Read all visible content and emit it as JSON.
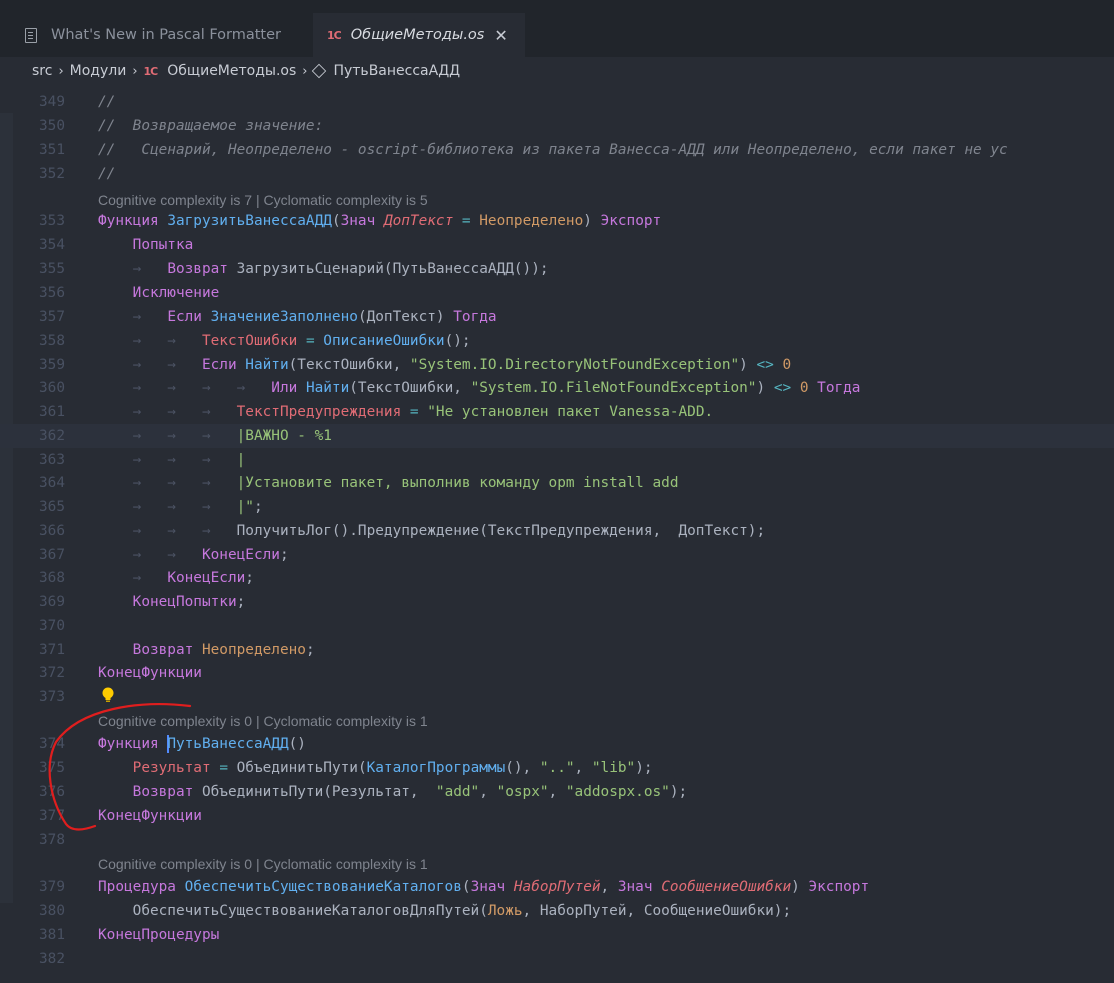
{
  "tabs": [
    {
      "label": "What's New in Pascal Formatter",
      "icon": "file-icon",
      "active": false
    },
    {
      "label": "ОбщиеМетоды.os",
      "icon": "1c-icon",
      "icon_text": "1С",
      "active": true,
      "close": "✕"
    }
  ],
  "breadcrumb": {
    "items": [
      "src",
      "Модули",
      "ОбщиеМетоды.os",
      "ПутьВанессаАДД"
    ],
    "separator": "›",
    "file_icon_text": "1С"
  },
  "lenses": {
    "l353": "Cognitive complexity is 7 | Cyclomatic complexity is 5",
    "l374": "Cognitive complexity is 0 | Cyclomatic complexity is 1",
    "l379": "Cognitive complexity is 0 | Cyclomatic complexity is 1"
  },
  "lines": [
    {
      "n": "349",
      "segs": [
        [
          "c",
          "//"
        ]
      ]
    },
    {
      "n": "350",
      "segs": [
        [
          "c",
          "//  Возвращаемое значение:"
        ]
      ]
    },
    {
      "n": "351",
      "segs": [
        [
          "c",
          "//   Сценарий, Неопределено - oscript-библиотека из пакета Ванесса-АДД или Неопределено, если пакет не ус"
        ]
      ]
    },
    {
      "n": "352",
      "segs": [
        [
          "c",
          "//"
        ]
      ]
    },
    {
      "n": "353",
      "segs": [
        [
          "k",
          "Функция "
        ],
        [
          "f",
          "ЗагрузитьВанессаАДД"
        ],
        [
          "t",
          "("
        ],
        [
          "k",
          "Знач "
        ],
        [
          "p",
          "ДопТекст"
        ],
        [
          "t",
          " "
        ],
        [
          "o",
          "="
        ],
        [
          "t",
          " "
        ],
        [
          "n",
          "Неопределено"
        ],
        [
          "t",
          ") "
        ],
        [
          "k",
          "Экспорт"
        ]
      ]
    },
    {
      "n": "354",
      "segs": [
        [
          "g",
          "    "
        ],
        [
          "k",
          "Попытка"
        ]
      ]
    },
    {
      "n": "355",
      "segs": [
        [
          "g",
          "    →   "
        ],
        [
          "k",
          "Возврат "
        ],
        [
          "t",
          "ЗагрузитьСценарий(ПутьВанессаАДД());"
        ]
      ]
    },
    {
      "n": "356",
      "segs": [
        [
          "g",
          "    "
        ],
        [
          "k",
          "Исключение"
        ]
      ]
    },
    {
      "n": "357",
      "segs": [
        [
          "g",
          "    →   "
        ],
        [
          "k",
          "Если "
        ],
        [
          "f",
          "ЗначениеЗаполнено"
        ],
        [
          "t",
          "(ДопТекст) "
        ],
        [
          "k",
          "Тогда"
        ]
      ]
    },
    {
      "n": "358",
      "segs": [
        [
          "g",
          "    →   →   "
        ],
        [
          "v",
          "ТекстОшибки"
        ],
        [
          "t",
          " "
        ],
        [
          "o",
          "="
        ],
        [
          "t",
          " "
        ],
        [
          "f",
          "ОписаниеОшибки"
        ],
        [
          "t",
          "();"
        ]
      ]
    },
    {
      "n": "359",
      "segs": [
        [
          "g",
          "    →   →   "
        ],
        [
          "k",
          "Если "
        ],
        [
          "f",
          "Найти"
        ],
        [
          "t",
          "(ТекстОшибки, "
        ],
        [
          "s",
          "\"System.IO.DirectoryNotFoundException\""
        ],
        [
          "t",
          ") "
        ],
        [
          "o",
          "<>"
        ],
        [
          "t",
          " "
        ],
        [
          "n",
          "0"
        ]
      ]
    },
    {
      "n": "360",
      "segs": [
        [
          "g",
          "    →   →   →   →   "
        ],
        [
          "k",
          "Или "
        ],
        [
          "f",
          "Найти"
        ],
        [
          "t",
          "(ТекстОшибки, "
        ],
        [
          "s",
          "\"System.IO.FileNotFoundException\""
        ],
        [
          "t",
          ") "
        ],
        [
          "o",
          "<>"
        ],
        [
          "t",
          " "
        ],
        [
          "n",
          "0"
        ],
        [
          "t",
          " "
        ],
        [
          "k",
          "Тогда"
        ]
      ]
    },
    {
      "n": "361",
      "segs": [
        [
          "g",
          "    →   →   →   "
        ],
        [
          "v",
          "ТекстПредупреждения"
        ],
        [
          "t",
          " "
        ],
        [
          "o",
          "="
        ],
        [
          "t",
          " "
        ],
        [
          "s",
          "\"Не установлен пакет Vanessa-ADD."
        ]
      ]
    },
    {
      "n": "362",
      "segs": [
        [
          "g",
          "    →   →   →   "
        ],
        [
          "s",
          "|ВАЖНО - %1"
        ]
      ]
    },
    {
      "n": "363",
      "segs": [
        [
          "g",
          "    →   →   →   "
        ],
        [
          "s",
          "|"
        ]
      ]
    },
    {
      "n": "364",
      "segs": [
        [
          "g",
          "    →   →   →   "
        ],
        [
          "s",
          "|Установите пакет, выполнив команду opm install add"
        ]
      ]
    },
    {
      "n": "365",
      "segs": [
        [
          "g",
          "    →   →   →   "
        ],
        [
          "s",
          "|\""
        ],
        [
          "t",
          ";"
        ]
      ]
    },
    {
      "n": "366",
      "segs": [
        [
          "g",
          "    →   →   →   "
        ],
        [
          "t",
          "ПолучитьЛог().Предупреждение(ТекстПредупреждения,  ДопТекст);"
        ]
      ]
    },
    {
      "n": "367",
      "segs": [
        [
          "g",
          "    →   →   "
        ],
        [
          "k",
          "КонецЕсли"
        ],
        [
          "t",
          ";"
        ]
      ]
    },
    {
      "n": "368",
      "segs": [
        [
          "g",
          "    →   "
        ],
        [
          "k",
          "КонецЕсли"
        ],
        [
          "t",
          ";"
        ]
      ]
    },
    {
      "n": "369",
      "segs": [
        [
          "g",
          "    "
        ],
        [
          "k",
          "КонецПопытки"
        ],
        [
          "t",
          ";"
        ]
      ]
    },
    {
      "n": "370",
      "segs": []
    },
    {
      "n": "371",
      "segs": [
        [
          "g",
          "    "
        ],
        [
          "k",
          "Возврат "
        ],
        [
          "n",
          "Неопределено"
        ],
        [
          "t",
          ";"
        ]
      ]
    },
    {
      "n": "372",
      "segs": [
        [
          "k",
          "КонецФункции"
        ]
      ]
    },
    {
      "n": "373",
      "segs": []
    },
    {
      "n": "374",
      "segs": [
        [
          "k",
          "Функция "
        ],
        [
          "cursor",
          ""
        ],
        [
          "f",
          "ПутьВанессаАДД"
        ],
        [
          "t",
          "()"
        ]
      ]
    },
    {
      "n": "375",
      "segs": [
        [
          "g",
          "    "
        ],
        [
          "v",
          "Результат"
        ],
        [
          "t",
          " "
        ],
        [
          "o",
          "="
        ],
        [
          "t",
          " ОбъединитьПути("
        ],
        [
          "f",
          "КаталогПрограммы"
        ],
        [
          "t",
          "(), "
        ],
        [
          "s",
          "\"..\""
        ],
        [
          "t",
          ", "
        ],
        [
          "s",
          "\"lib\""
        ],
        [
          "t",
          ");"
        ]
      ]
    },
    {
      "n": "376",
      "segs": [
        [
          "g",
          "    "
        ],
        [
          "k",
          "Возврат "
        ],
        [
          "t",
          "ОбъединитьПути(Результат,  "
        ],
        [
          "s",
          "\"add\""
        ],
        [
          "t",
          ", "
        ],
        [
          "s",
          "\"ospx\""
        ],
        [
          "t",
          ", "
        ],
        [
          "s",
          "\"addospx.os\""
        ],
        [
          "t",
          ");"
        ]
      ]
    },
    {
      "n": "377",
      "segs": [
        [
          "k",
          "КонецФункции"
        ]
      ]
    },
    {
      "n": "378",
      "segs": []
    },
    {
      "n": "379",
      "segs": [
        [
          "k",
          "Процедура "
        ],
        [
          "f",
          "ОбеспечитьСуществованиеКаталогов"
        ],
        [
          "t",
          "("
        ],
        [
          "k",
          "Знач "
        ],
        [
          "p",
          "НаборПутей"
        ],
        [
          "t",
          ", "
        ],
        [
          "k",
          "Знач "
        ],
        [
          "p",
          "СообщениеОшибки"
        ],
        [
          "t",
          ") "
        ],
        [
          "k",
          "Экспорт"
        ]
      ]
    },
    {
      "n": "380",
      "segs": [
        [
          "g",
          "    "
        ],
        [
          "t",
          "ОбеспечитьСуществованиеКаталоговДляПутей("
        ],
        [
          "n",
          "Ложь"
        ],
        [
          "t",
          ", НаборПутей, СообщениеОшибки);"
        ]
      ]
    },
    {
      "n": "381",
      "segs": [
        [
          "k",
          "КонецПроцедуры"
        ]
      ]
    },
    {
      "n": "382",
      "segs": []
    }
  ]
}
